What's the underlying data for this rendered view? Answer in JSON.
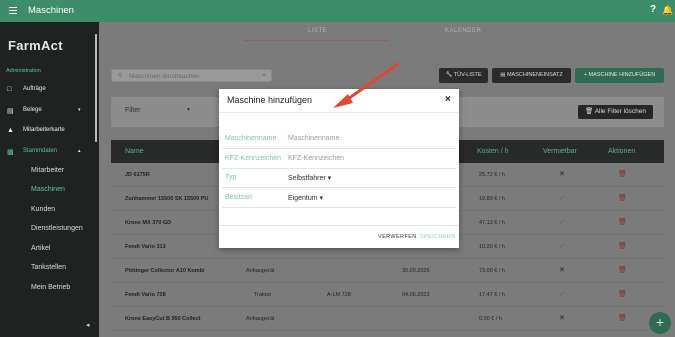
{
  "colors": {
    "brand": "#3d8c6b",
    "sidebar": "#1e2322",
    "accent_text": "#5fc496",
    "arrow": "#e0492f",
    "trash": "#c0392b"
  },
  "header": {
    "title": "Maschinen",
    "help": "?",
    "bell_icon": "bell-icon"
  },
  "sidebar": {
    "logo": "FarmAct",
    "section": "Administration",
    "items": [
      {
        "label": "Aufträge",
        "icon": "clipboard-icon"
      },
      {
        "label": "Belege",
        "icon": "document-icon",
        "chevron": "▾"
      },
      {
        "label": "Mitarbeiterkarte",
        "icon": "map-icon"
      },
      {
        "label": "Stammdaten",
        "icon": "chart-icon",
        "chevron": "▴"
      }
    ],
    "subitems": [
      "Mitarbeiter",
      "Maschinen",
      "Kunden",
      "Dienstleistungen",
      "Artikel",
      "Tankstellen",
      "Mein Betrieb"
    ],
    "collapse": "◂"
  },
  "tabs": [
    "LISTE",
    "KALENDER"
  ],
  "search": {
    "placeholder": "Maschinen durchsuchen",
    "clear": "×"
  },
  "buttons": {
    "tuev": "TÜV-LISTE",
    "einsatz": "MASCHINENEINSATZ",
    "add": "+ MASCHINE HINZUFÜGEN"
  },
  "filter": {
    "label": "Filter",
    "clear": "Alle Filter löschen"
  },
  "table": {
    "headers": [
      "Name",
      "Kosten / h",
      "Vermietbar",
      "Aktionen"
    ],
    "rows": [
      {
        "name": "JD 6175R",
        "type": "",
        "plate": "",
        "date": "",
        "cost": "25,72 € / h",
        "rentable": false
      },
      {
        "name": "Zunhammer 15500 SK 15500 PU",
        "type": "",
        "plate": "",
        "date": "",
        "cost": "19,89 € / h",
        "rentable": true
      },
      {
        "name": "Krone MX 370 GD",
        "type": "",
        "plate": "",
        "date": "",
        "cost": "47,13 € / h",
        "rentable": true
      },
      {
        "name": "Fendt Vario 313",
        "type": "",
        "plate": "",
        "date": "",
        "cost": "10,20 € / h",
        "rentable": true
      },
      {
        "name": "Pöttinger Collector A10 Kombi",
        "type": "Anbaugerät",
        "plate": "",
        "date": "30.09.2026",
        "cost": "73,00 € / h",
        "rentable": false
      },
      {
        "name": "Fendt Vario 728",
        "type": "Traktor",
        "plate": "A-LM 728",
        "date": "04.06.2023",
        "cost": "17,47 € / h",
        "rentable": true
      },
      {
        "name": "Krone EasyCut B 950 Collect",
        "type": "Anbaugerät",
        "plate": "",
        "date": "",
        "cost": "0,00 € / h",
        "rentable": false
      }
    ]
  },
  "modal": {
    "title": "Maschine hinzufügen",
    "close": "×",
    "fields": [
      {
        "label": "Maschinenname",
        "placeholder": "Maschinenname"
      },
      {
        "label": "KFZ-Kennzeichen",
        "placeholder": "KFZ-Kennzeichen"
      },
      {
        "label": "Typ",
        "value": "Selbstfahrer ▾"
      },
      {
        "label": "Besitzart",
        "value": "Eigentum ▾"
      }
    ],
    "discard": "VERWERFEN",
    "save": "SPEICHERN"
  },
  "fab": "+"
}
